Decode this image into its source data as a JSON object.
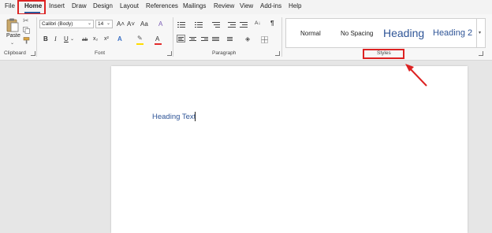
{
  "tabs": [
    "File",
    "Home",
    "Insert",
    "Draw",
    "Design",
    "Layout",
    "References",
    "Mailings",
    "Review",
    "View",
    "Add-ins",
    "Help"
  ],
  "active_tab": "Home",
  "clipboard": {
    "paste_label": "Paste",
    "group_label": "Clipboard"
  },
  "font": {
    "family_value": "Calibri (Body)",
    "size_value": "14",
    "grow_label": "A˄",
    "shrink_label": "A˅",
    "case_label": "Aa",
    "clear_label": "A",
    "bold": "B",
    "italic": "I",
    "underline": "U",
    "strike": "ab",
    "subscript": "x₂",
    "superscript": "x²",
    "effects": "A",
    "highlight": "✎",
    "color": "A",
    "group_label": "Font"
  },
  "paragraph": {
    "pilcrow": "¶",
    "sort": "A↓",
    "group_label": "Paragraph"
  },
  "styles": {
    "items": [
      "Normal",
      "No Spacing",
      "Heading",
      "Heading 2"
    ],
    "group_label": "Styles"
  },
  "document": {
    "text": "Heading Text"
  },
  "colors": {
    "accent": "#2b579a",
    "heading": "#2f5597",
    "annotation_red": "#dd2222",
    "highlight_yellow": "#ffdc00",
    "font_color_red": "#e32b2b"
  },
  "icons": {
    "paste": "clipboard-icon",
    "cut": "scissors-icon",
    "copy": "copy-icon",
    "format_painter": "paintbrush-icon",
    "launcher": "dialog-launcher-icon",
    "arrow": "annotation-arrow-icon"
  }
}
